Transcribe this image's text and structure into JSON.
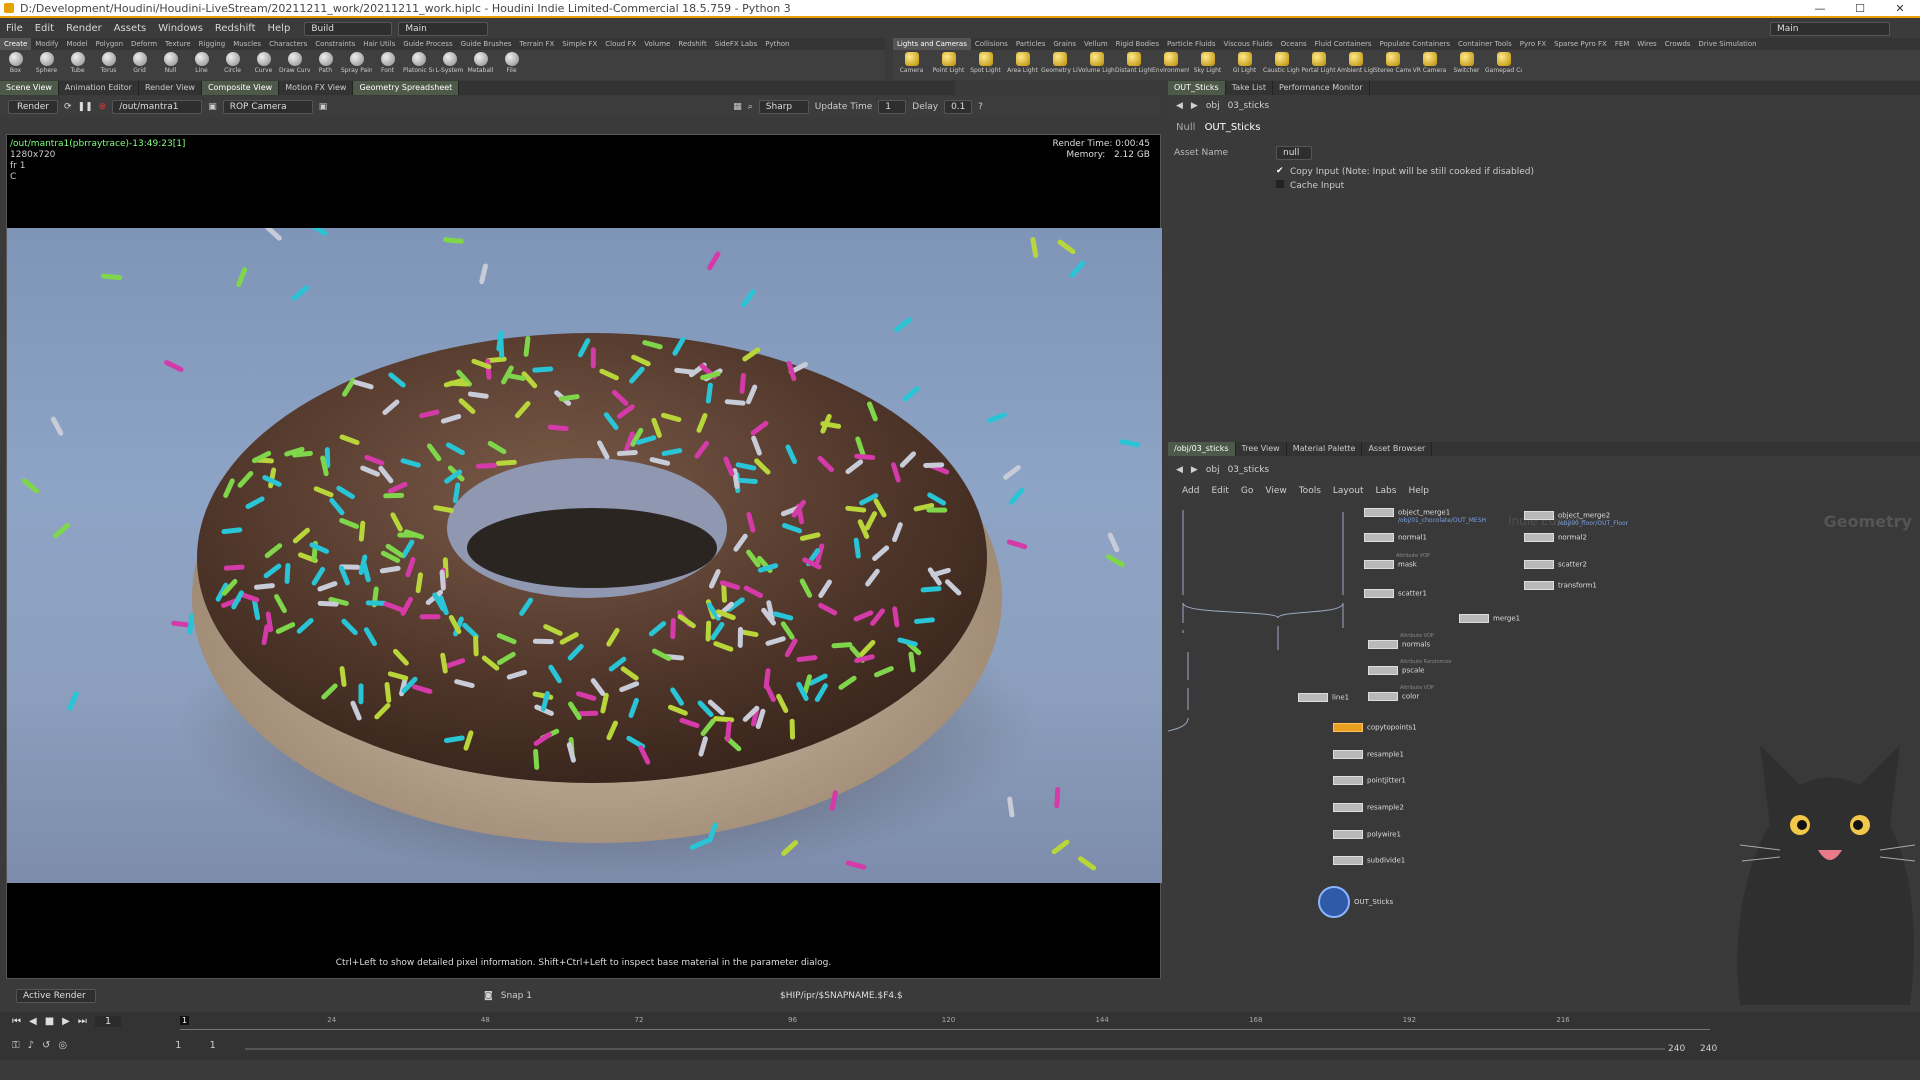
{
  "window": {
    "title": "D:/Development/Houdini/Houdini-LiveStream/20211211_work/20211211_work.hiplc - Houdini Indie Limited-Commercial 18.5.759 - Python 3"
  },
  "menu": [
    "File",
    "Edit",
    "Render",
    "Assets",
    "Windows",
    "Redshift",
    "Help"
  ],
  "desktop": {
    "build_label": "Build",
    "main_label": "Main",
    "right_main_label": "Main"
  },
  "shelf_tabs_left": [
    "Create",
    "Modify",
    "Model",
    "Polygon",
    "Deform",
    "Texture",
    "Rigging",
    "Muscles",
    "Characters",
    "Constraints",
    "Hair Utils",
    "Guide Process",
    "Guide Brushes",
    "Terrain FX",
    "Simple FX",
    "Cloud FX",
    "Volume",
    "Redshift",
    "SideFX Labs",
    "Python"
  ],
  "shelf_tools_left": [
    "Box",
    "Sphere",
    "Tube",
    "Torus",
    "Grid",
    "Null",
    "Line",
    "Circle",
    "Curve",
    "Draw Curve",
    "Path",
    "Spray Paint",
    "Font",
    "Platonic Solids",
    "L-System",
    "Metaball",
    "File"
  ],
  "shelf_tabs_right": [
    "Lights and Cameras",
    "Collisions",
    "Particles",
    "Grains",
    "Vellum",
    "Rigid Bodies",
    "Particle Fluids",
    "Viscous Fluids",
    "Oceans",
    "Fluid Containers",
    "Populate Containers",
    "Container Tools",
    "Pyro FX",
    "Sparse Pyro FX",
    "FEM",
    "Wires",
    "Crowds",
    "Drive Simulation"
  ],
  "shelf_tools_right": [
    "Camera",
    "Point Light",
    "Spot Light",
    "Area Light",
    "Geometry Light",
    "Volume Light",
    "Distant Light",
    "Environment Light",
    "Sky Light",
    "GI Light",
    "Caustic Light",
    "Portal Light",
    "Ambient Light",
    "Stereo Camera",
    "VR Camera",
    "Switcher",
    "Gamepad Camera"
  ],
  "pane_tabs_left": [
    "Scene View",
    "Animation Editor",
    "Render View",
    "Composite View",
    "Motion FX View",
    "Geometry Spreadsheet"
  ],
  "render_toolbar": {
    "render_btn": "Render",
    "driver_path": "/out/mantra1",
    "camera": "ROP Camera",
    "sharp": "Sharp",
    "update_label": "Update Time",
    "update_value": "1",
    "delay_label": "Delay",
    "delay_value": "0.1"
  },
  "render": {
    "info_line1": "/out/mantra1(pbrraytrace)-13:49:23[1]",
    "info_line2": "1280x720",
    "info_line3": "fr 1",
    "info_line4": "C",
    "time_label": "Render Time: 0:00:45",
    "mem_label": "Memory:",
    "mem_value": "2.12 GB",
    "hint": "Ctrl+Left to show detailed pixel information. Shift+Ctrl+Left to inspect base material in the parameter dialog."
  },
  "viewport_status": {
    "active": "Active Render",
    "snap": "Snap 1",
    "ipr_path": "$HIP/ipr/$SNAPNAME.$F4.$"
  },
  "pane_tabs_right_top": [
    "OUT_Sticks",
    "Take List",
    "Performance Monitor"
  ],
  "param": {
    "path_obj": "obj",
    "path_node": "03_sticks",
    "node_type": "Null",
    "node_name": "OUT_Sticks",
    "asset_label": "Asset Name",
    "asset_value": "null",
    "copy_input": "Copy Input (Note: Input will be still cooked if disabled)",
    "cache_input": "Cache Input"
  },
  "pane_tabs_right_bottom": [
    "/obj/03_sticks",
    "Tree View",
    "Material Palette",
    "Asset Browser"
  ],
  "net": {
    "path_obj": "obj",
    "path_node": "03_sticks",
    "menu": [
      "Add",
      "Edit",
      "Go",
      "View",
      "Tools",
      "Layout",
      "Labs",
      "Help"
    ],
    "watermark": "Geometry",
    "edition_watermark": "Indie Edition"
  },
  "nodes": [
    {
      "name": "object_merge1",
      "sub": "/obj/01_chocolate/OUT_MESH"
    },
    {
      "name": "object_merge2",
      "sub": "/obj/00_floor/OUT_Floor"
    },
    {
      "name": "normal1"
    },
    {
      "name": "normal2"
    },
    {
      "name": "mask",
      "tag": "Attribute VOP"
    },
    {
      "name": "scatter2"
    },
    {
      "name": "scatter1"
    },
    {
      "name": "transform1"
    },
    {
      "name": "merge1"
    },
    {
      "name": "normals",
      "tag": "Attribute VOP"
    },
    {
      "name": "pscale",
      "tag": "Attribute Randomize"
    },
    {
      "name": "color",
      "tag": "Attribute VOP"
    },
    {
      "name": "line1"
    },
    {
      "name": "copytopoints1"
    },
    {
      "name": "resample1"
    },
    {
      "name": "pointjitter1"
    },
    {
      "name": "resample2"
    },
    {
      "name": "polywire1"
    },
    {
      "name": "subdivide1"
    },
    {
      "name": "OUT_Sticks"
    }
  ],
  "timeline": {
    "frame": "1",
    "start": "1",
    "start2": "1",
    "end": "240",
    "end2": "240",
    "ticks": [
      "24",
      "48",
      "72",
      "96",
      "120",
      "144",
      "168",
      "192",
      "216"
    ]
  },
  "colors": {
    "accent": "#e8a000",
    "node_selected": "#e8a020",
    "render_frame_green": "#58c058"
  }
}
